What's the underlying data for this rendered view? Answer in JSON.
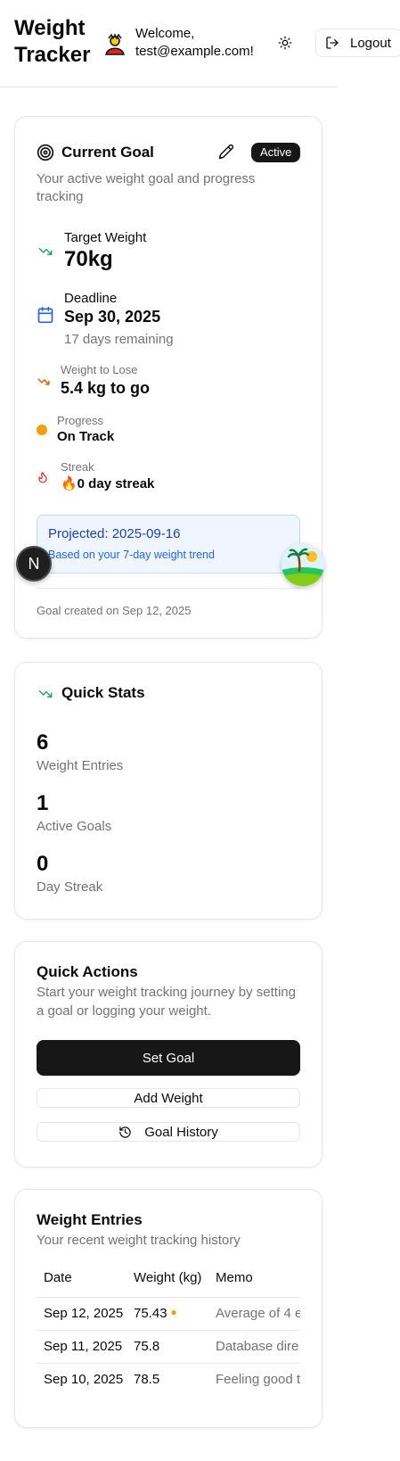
{
  "header": {
    "title": "Weight Tracker",
    "welcome": "Welcome, test@example.com!",
    "logout_label": "Logout"
  },
  "goal": {
    "title": "Current Goal",
    "status": "Active",
    "subtitle": "Your active weight goal and progress tracking",
    "target_label": "Target Weight",
    "target_value": "70kg",
    "deadline_label": "Deadline",
    "deadline_value": "Sep 30, 2025",
    "days_remaining": "17 days remaining",
    "to_lose_label": "Weight to Lose",
    "to_lose_value": "5.4 kg to go",
    "progress_label": "Progress",
    "progress_value": "On Track",
    "streak_label": "Streak",
    "streak_value": "🔥0 day streak",
    "projected": "Projected: 2025-09-16",
    "projected_note": "Based on your 7-day weight trend",
    "created": "Goal created on Sep 12, 2025",
    "colors": {
      "trend": "#16a34a",
      "deadline": "#2563eb",
      "lose": "#ea580c",
      "progress_dot": "#f59e0b",
      "streak": "#dc2626"
    }
  },
  "fab": {
    "n_label": "N"
  },
  "stats": {
    "title": "Quick Stats",
    "items": [
      {
        "value": "6",
        "label": "Weight Entries"
      },
      {
        "value": "1",
        "label": "Active Goals"
      },
      {
        "value": "0",
        "label": "Day Streak"
      }
    ]
  },
  "actions": {
    "title": "Quick Actions",
    "subtitle": "Start your weight tracking journey by setting a goal or logging your weight.",
    "set_goal": "Set Goal",
    "add_weight": "Add Weight",
    "goal_history": "Goal History"
  },
  "entries": {
    "title": "Weight Entries",
    "subtitle": "Your recent weight tracking history",
    "columns": [
      "Date",
      "Weight (kg)",
      "Memo"
    ],
    "rows": [
      {
        "date": "Sep 12, 2025",
        "weight": "75.43",
        "memo": "Average of 4 e"
      },
      {
        "date": "Sep 11, 2025",
        "weight": "75.8",
        "memo": "Database dire"
      },
      {
        "date": "Sep 10, 2025",
        "weight": "78.5",
        "memo": "Feeling good t"
      }
    ]
  },
  "icons": [
    "avatar-icon",
    "sun-icon",
    "logout-icon",
    "target-icon",
    "pencil-icon",
    "trend-down-icon",
    "calendar-icon",
    "flame-icon",
    "history-icon"
  ]
}
